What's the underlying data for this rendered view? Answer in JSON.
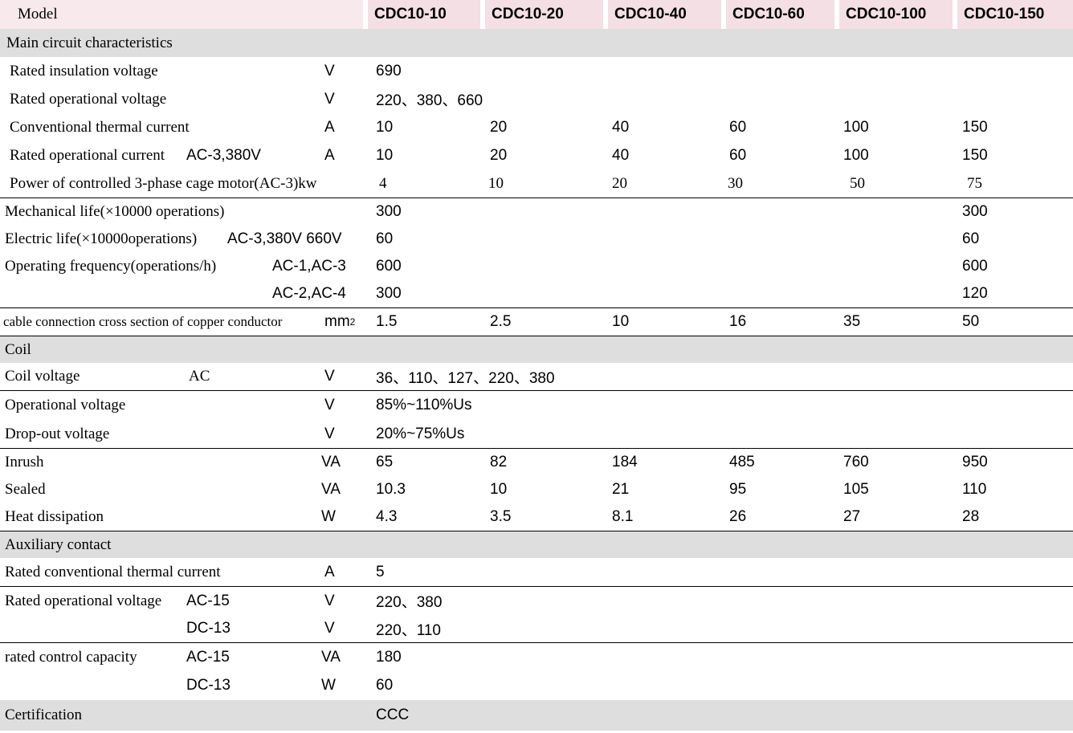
{
  "table": {
    "header": {
      "model_label": "Model",
      "models": [
        "CDC10-10",
        "CDC10-20",
        "CDC10-40",
        "CDC10-60",
        "CDC10-100",
        "CDC10-150"
      ]
    },
    "sections": [
      {
        "title": "Main circuit characteristics"
      },
      {
        "title": "Coil"
      },
      {
        "title": "Auxiliary contact"
      },
      {
        "title": "Certification"
      }
    ],
    "rows": {
      "rated_insulation_voltage": {
        "label": "Rated insulation voltage",
        "sublabel": "",
        "unit": "V",
        "values": [
          "690",
          "",
          "",
          "",
          "",
          ""
        ]
      },
      "rated_operational_voltage": {
        "label": "Rated operational voltage",
        "sublabel": "",
        "unit": "V",
        "values": [
          "220、380、660",
          "",
          "",
          "",
          "",
          ""
        ]
      },
      "conventional_thermal_current": {
        "label": "Conventional thermal current",
        "sublabel": "",
        "unit": "A",
        "values": [
          "10",
          "20",
          "40",
          "60",
          "100",
          "150"
        ]
      },
      "rated_operational_current": {
        "label": "Rated operational current",
        "sublabel": "AC-3,380V",
        "unit": "A",
        "values": [
          "10",
          "20",
          "40",
          "60",
          "100",
          "150"
        ]
      },
      "power_controlled_motor": {
        "label": "Power of controlled 3-phase cage motor(AC-3)kw",
        "sublabel": "",
        "unit": "",
        "values": [
          "4",
          "10",
          "20",
          "30",
          "50",
          "75"
        ]
      },
      "mechanical_life": {
        "label": "Mechanical life(×10000 operations)",
        "sublabel": "",
        "unit": "",
        "values": [
          "300",
          "",
          "",
          "",
          "",
          "300"
        ]
      },
      "electric_life": {
        "label": "Electric life(×10000operations)",
        "sublabel": "AC-3,380V 660V",
        "unit": "",
        "values": [
          "60",
          "",
          "",
          "",
          "",
          "60"
        ]
      },
      "operating_frequency_1": {
        "label": "Operating frequency(operations/h)",
        "sublabel": "AC-1,AC-3",
        "unit": "",
        "values": [
          "600",
          "",
          "",
          "",
          "",
          "600"
        ]
      },
      "operating_frequency_2": {
        "label": "",
        "sublabel": "AC-2,AC-4",
        "unit": "",
        "values": [
          "300",
          "",
          "",
          "",
          "",
          "120"
        ]
      },
      "cable_connection": {
        "label": "cable connection cross section of copper conductor",
        "sublabel": "",
        "unit": "mm2",
        "values": [
          "1.5",
          "2.5",
          "10",
          "16",
          "35",
          "50"
        ]
      },
      "coil_voltage": {
        "label": "Coil voltage",
        "sublabel": "AC",
        "unit": "V",
        "values": [
          "36、110、127、220、380",
          "",
          "",
          "",
          "",
          ""
        ]
      },
      "operational_voltage": {
        "label": "Operational voltage",
        "sublabel": "",
        "unit": "V",
        "values": [
          "85%~110%Us",
          "",
          "",
          "",
          "",
          ""
        ]
      },
      "drop_out_voltage": {
        "label": "Drop-out voltage",
        "sublabel": "",
        "unit": "V",
        "values": [
          "20%~75%Us",
          "",
          "",
          "",
          "",
          ""
        ]
      },
      "inrush": {
        "label": "Inrush",
        "sublabel": "",
        "unit": "VA",
        "values": [
          "65",
          "82",
          "184",
          "485",
          "760",
          "950"
        ]
      },
      "sealed": {
        "label": "Sealed",
        "sublabel": "",
        "unit": "VA",
        "values": [
          "10.3",
          "10",
          "21",
          "95",
          "105",
          "110"
        ]
      },
      "heat_dissipation": {
        "label": "Heat dissipation",
        "sublabel": "",
        "unit": "W",
        "values": [
          "4.3",
          "3.5",
          "8.1",
          "26",
          "27",
          "28"
        ]
      },
      "aux_rated_thermal_current": {
        "label": "Rated conventional thermal current",
        "sublabel": "",
        "unit": "A",
        "values": [
          "5",
          "",
          "",
          "",
          "",
          ""
        ]
      },
      "aux_rated_op_voltage_ac15": {
        "label": "Rated operational voltage",
        "sublabel": "AC-15",
        "unit": "V",
        "values": [
          "220、380",
          "",
          "",
          "",
          "",
          ""
        ]
      },
      "aux_rated_op_voltage_dc13": {
        "label": "",
        "sublabel": "DC-13",
        "unit": "V",
        "values": [
          "220、110",
          "",
          "",
          "",
          "",
          ""
        ]
      },
      "rated_control_capacity_ac15": {
        "label": "rated control capacity",
        "sublabel": "AC-15",
        "unit": "VA",
        "values": [
          "180",
          "",
          "",
          "",
          "",
          ""
        ]
      },
      "rated_control_capacity_dc13": {
        "label": "",
        "sublabel": "DC-13",
        "unit": "W",
        "values": [
          "60",
          "",
          "",
          "",
          "",
          ""
        ]
      },
      "certification": {
        "label": "Certification",
        "sublabel": "",
        "unit": "",
        "values": [
          "CCC",
          "",
          "",
          "",
          "",
          ""
        ]
      }
    }
  }
}
